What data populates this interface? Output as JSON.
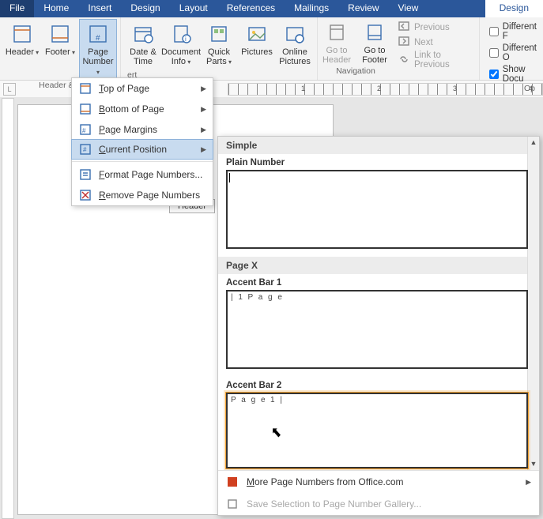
{
  "tabs": {
    "file": "File",
    "home": "Home",
    "insert": "Insert",
    "design": "Design",
    "layout": "Layout",
    "references": "References",
    "mailings": "Mailings",
    "review": "Review",
    "view": "View",
    "tool_design": "Design"
  },
  "ribbon": {
    "header": "Header",
    "footer": "Footer",
    "page_number": "Page Number",
    "date_time": "Date & Time",
    "doc_info": "Document Info",
    "quick_parts": "Quick Parts",
    "pictures": "Pictures",
    "online_pictures": "Online Pictures",
    "goto_header": "Go to Header",
    "goto_footer": "Go to Footer",
    "previous": "Previous",
    "next": "Next",
    "link_prev": "Link to Previous",
    "diff_first": "Different F",
    "diff_odd": "Different O",
    "show_doc": "Show Docu",
    "group_hf": "Header & F",
    "group_insert": "ert",
    "group_nav": "Navigation",
    "group_opt": "Op"
  },
  "ruler": {
    "box": "L",
    "n1": "1",
    "n2": "2",
    "n3": "3",
    "n4": "4"
  },
  "page": {
    "header_tag": "Header"
  },
  "pn_menu": {
    "top": "Top of Page",
    "bottom": "Bottom of Page",
    "margins": "Page Margins",
    "current": "Current Position",
    "format": "Format Page Numbers...",
    "remove": "Remove Page Numbers"
  },
  "gallery": {
    "simple": "Simple",
    "plain": "Plain Number",
    "pagex": "Page X",
    "ab1": "Accent Bar 1",
    "ab2": "Accent Bar 2",
    "pv_page": "P a g e",
    "pv_bar": "1 |",
    "pv_bar2": "| 1",
    "more": "More Page Numbers from Office.com",
    "save": "Save Selection to Page Number Gallery..."
  }
}
